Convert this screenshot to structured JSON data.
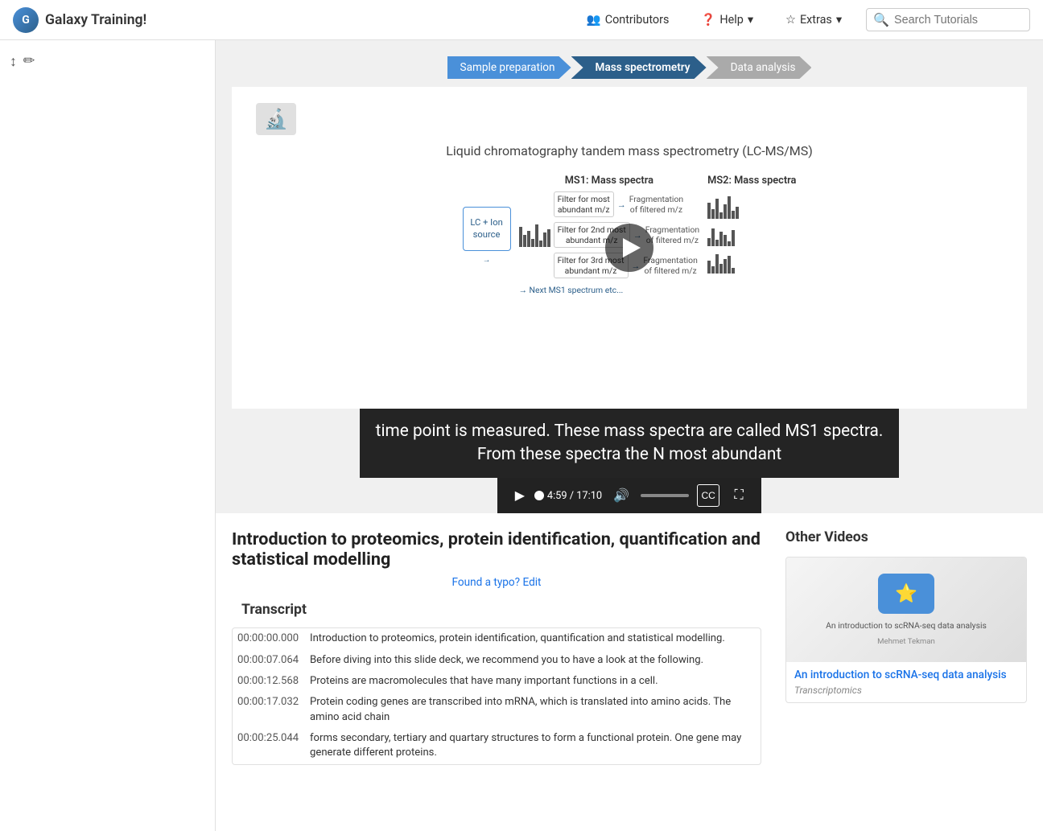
{
  "navbar": {
    "brand": "Galaxy Training!",
    "contributors_label": "Contributors",
    "help_label": "Help",
    "extras_label": "Extras",
    "search_placeholder": "Search Tutorials"
  },
  "sidebar": {
    "controls": [
      "↕",
      "✏"
    ]
  },
  "breadcrumb": {
    "steps": [
      {
        "label": "Sample preparation",
        "state": "active"
      },
      {
        "label": "Mass spectrometry",
        "state": "current"
      },
      {
        "label": "Data analysis",
        "state": "inactive"
      }
    ]
  },
  "slide": {
    "title": "Liquid chromatography tandem mass spectrometry (LC-MS/MS)",
    "ms1_header": "MS1: Mass spectra",
    "ms2_header": "MS2: Mass spectra",
    "lc_label": "LC + Ion source",
    "next_label": "→ Next MS1 spectrum etc..."
  },
  "subtitles": {
    "line1": "time point is measured. These mass spectra are called MS1 spectra.",
    "line2": "From these spectra the N most abundant"
  },
  "controls": {
    "current_time": "4:59",
    "separator": "/",
    "total_time": "17:10",
    "progress_percent": 29
  },
  "video_info": {
    "title": "Introduction to proteomics, protein identification, quantification and statistical modelling",
    "typo_link": "Found a typo? Edit"
  },
  "transcript": {
    "heading": "Transcript",
    "entries": [
      {
        "time": "00:00:00.000",
        "text": "Introduction to proteomics, protein identification, quantification and statistical modelling."
      },
      {
        "time": "00:00:07.064",
        "text": "Before diving into this slide deck, we recommend you to have a look at the following."
      },
      {
        "time": "00:00:12.568",
        "text": "Proteins are macromolecules that have many important functions in a cell."
      },
      {
        "time": "00:00:17.032",
        "text": "Protein coding genes are transcribed into mRNA, which is translated into amino acids. The amino acid chain"
      },
      {
        "time": "00:00:25.044",
        "text": "forms secondary, tertiary and quartary structures to form a functional protein. One gene may generate different proteins."
      }
    ]
  },
  "other_videos": {
    "heading": "Other Videos",
    "cards": [
      {
        "title": "An introduction to scRNA-seq data analysis",
        "tag": "Transcriptomics",
        "thumb_text": "An introduction to scRNA-seq data analysis",
        "thumb_author": "Mehmet Tekman"
      }
    ]
  }
}
